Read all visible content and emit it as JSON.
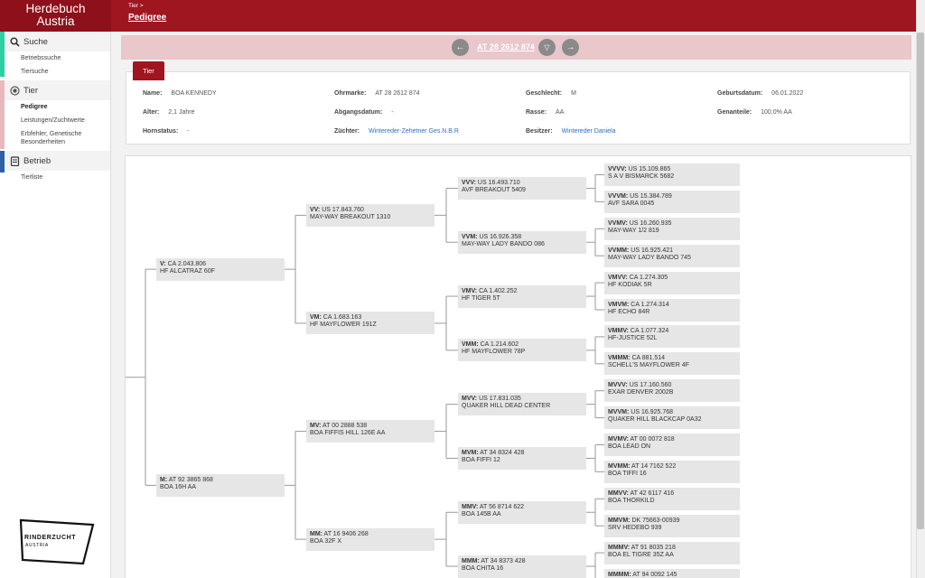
{
  "header": {
    "logo_line1": "Herdebuch",
    "logo_line2": "Austria",
    "breadcrumb": "Tier >",
    "title": "Pedigree"
  },
  "sidebar": {
    "groups": [
      {
        "label": "Suche",
        "accent": "#2ecfa0",
        "icon": "search-icon",
        "items": [
          {
            "label": "Betriebssuche"
          },
          {
            "label": "Tiersuche"
          }
        ]
      },
      {
        "label": "Tier",
        "accent": "#e8b9bc",
        "icon": "target-icon",
        "items": [
          {
            "label": "Pedigree",
            "active": true
          },
          {
            "label": "Leistungen/Zuchtwerte"
          },
          {
            "label": "Erbfehler, Genetische Besonderheiten"
          }
        ]
      },
      {
        "label": "Betrieb",
        "accent": "#2b5fa8",
        "icon": "barn-icon",
        "items": [
          {
            "label": "Tierliste"
          }
        ]
      }
    ],
    "logo_main": "RINDERZUCHT",
    "logo_sub": "AUSTRIA"
  },
  "nav": {
    "animal_id": "AT 28 2612 874"
  },
  "tab": {
    "label": "Tier"
  },
  "info": {
    "name_label": "Name:",
    "name": "BOA KENNEDY",
    "ohrmarke_label": "Ohrmarke:",
    "ohrmarke": "AT 28 2612 874",
    "geschlecht_label": "Geschlecht:",
    "geschlecht": "M",
    "geburtsdatum_label": "Geburtsdatum:",
    "geburtsdatum": "06.01.2022",
    "alter_label": "Alter:",
    "alter": "2,1 Jahre",
    "abgangsdatum_label": "Abgangsdatum:",
    "abgangsdatum": "-",
    "rasse_label": "Rasse:",
    "rasse": "AA",
    "genanteile_label": "Genanteile:",
    "genanteile": "100,0% AA",
    "hornstatus_label": "Hornstatus:",
    "hornstatus": "-",
    "zuechter_label": "Züchter:",
    "zuechter": "Wintereder-Zehetner Ges.N.B.R",
    "besitzer_label": "Besitzer:",
    "besitzer": "Wintereder Daniela"
  },
  "pedigree": {
    "V": {
      "role": "V:",
      "id": "CA 2.043.806",
      "name": "HF ALCATRAZ 60F"
    },
    "M": {
      "role": "M:",
      "id": "AT 92 3865 868",
      "name": "BOA 16H AA"
    },
    "VV": {
      "role": "VV:",
      "id": "US 17.843.760",
      "name": "MAY-WAY BREAKOUT 1310"
    },
    "VM": {
      "role": "VM:",
      "id": "CA 1.683.163",
      "name": "HF MAYFLOWER 191Z"
    },
    "MV": {
      "role": "MV:",
      "id": "AT 00 2888 538",
      "name": "BOA FIFFIS HILL 126E AA"
    },
    "MM": {
      "role": "MM:",
      "id": "AT 16 9406 268",
      "name": "BOA 32F X"
    },
    "VVV": {
      "role": "VVV:",
      "id": "US 16.493.710",
      "name": "AVF BREAKOUT 5409"
    },
    "VVM": {
      "role": "VVM:",
      "id": "US 16.926.358",
      "name": "MAY-WAY LADY BANDO 086"
    },
    "VMV": {
      "role": "VMV:",
      "id": "CA 1.402.252",
      "name": "HF TIGER 5T"
    },
    "VMM": {
      "role": "VMM:",
      "id": "CA 1.214.602",
      "name": "HF MAYFLOWER 78P"
    },
    "MVV": {
      "role": "MVV:",
      "id": "US 17.831.035",
      "name": "QUAKER HILL DEAD CENTER"
    },
    "MVM": {
      "role": "MVM:",
      "id": "AT 34 8324 428",
      "name": "BOA FIFFI 12"
    },
    "MMV": {
      "role": "MMV:",
      "id": "AT 56 8714 622",
      "name": "BOA 145B AA"
    },
    "MMM": {
      "role": "MMM:",
      "id": "AT 34 8373 428",
      "name": "BOA CHITA 16"
    },
    "VVVV": {
      "role": "VVVV:",
      "id": "US 15.109.865",
      "name": "S A V BISMARCK 5682"
    },
    "VVVM": {
      "role": "VVVM:",
      "id": "US 15.384.789",
      "name": "AVF SARA 0045"
    },
    "VVMV": {
      "role": "VVMV:",
      "id": "US 16.260.935",
      "name": "MAY-WAY 1/2 819"
    },
    "VVMM": {
      "role": "VVMM:",
      "id": "US 16.925.421",
      "name": "MAY-WAY LADY BANDO 745"
    },
    "VMVV": {
      "role": "VMVV:",
      "id": "CA 1.274.305",
      "name": "HF KODIAK 5R"
    },
    "VMVM": {
      "role": "VMVM:",
      "id": "CA 1.274.314",
      "name": "HF ECHO 84R"
    },
    "VMMV": {
      "role": "VMMV:",
      "id": "CA 1.077.324",
      "name": "HF-JUSTICE 52L"
    },
    "VMMM": {
      "role": "VMMM:",
      "id": "CA 881.514",
      "name": "SCHELL'S MAYFLOWER 4F"
    },
    "MVVV": {
      "role": "MVVV:",
      "id": "US 17.160.560",
      "name": "EXAR DENVER 2002B"
    },
    "MVVM": {
      "role": "MVVM:",
      "id": "US 16.925.768",
      "name": "QUAKER HILL BLACKCAP 0A32"
    },
    "MVMV": {
      "role": "MVMV:",
      "id": "AT 00 0072 818",
      "name": "BOA LEAD ON"
    },
    "MVMM": {
      "role": "MVMM:",
      "id": "AT 14 7162 522",
      "name": "BOA TIFFI 16"
    },
    "MMVV": {
      "role": "MMVV:",
      "id": "AT 42 6117 416",
      "name": "BOA THORKILD"
    },
    "MMVM": {
      "role": "MMVM:",
      "id": "DK 75663-00939",
      "name": "SRV HEDEBO 939"
    },
    "MMMV": {
      "role": "MMMV:",
      "id": "AT 91 8035 218",
      "name": "BOA EL TIGRE 35Z AA"
    },
    "MMMM": {
      "role": "MMMM:",
      "id": "AT 94 0092 145",
      "name": ""
    }
  },
  "colors": {
    "header_red": "#9f1620",
    "link_blue": "#2a6fbe"
  }
}
